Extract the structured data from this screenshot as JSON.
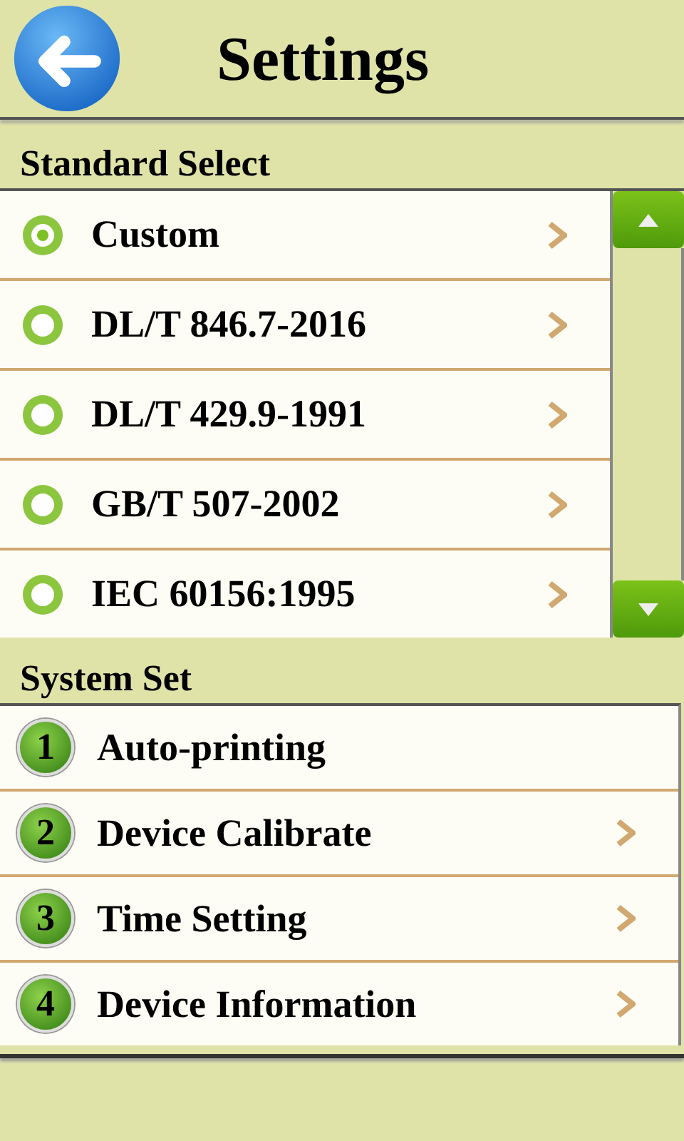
{
  "header": {
    "title": "Settings"
  },
  "standard_select": {
    "title": "Standard Select",
    "items": [
      {
        "label": "Custom",
        "selected": true
      },
      {
        "label": "DL/T 846.7-2016",
        "selected": false
      },
      {
        "label": "DL/T 429.9-1991",
        "selected": false
      },
      {
        "label": "GB/T 507-2002",
        "selected": false
      },
      {
        "label": "IEC 60156:1995",
        "selected": false
      }
    ]
  },
  "system_set": {
    "title": "System Set",
    "items": [
      {
        "number": "1",
        "label": "Auto-printing",
        "chevron": false
      },
      {
        "number": "2",
        "label": "Device Calibrate",
        "chevron": true
      },
      {
        "number": "3",
        "label": "Time Setting",
        "chevron": true
      },
      {
        "number": "4",
        "label": "Device Information",
        "chevron": true
      }
    ]
  }
}
